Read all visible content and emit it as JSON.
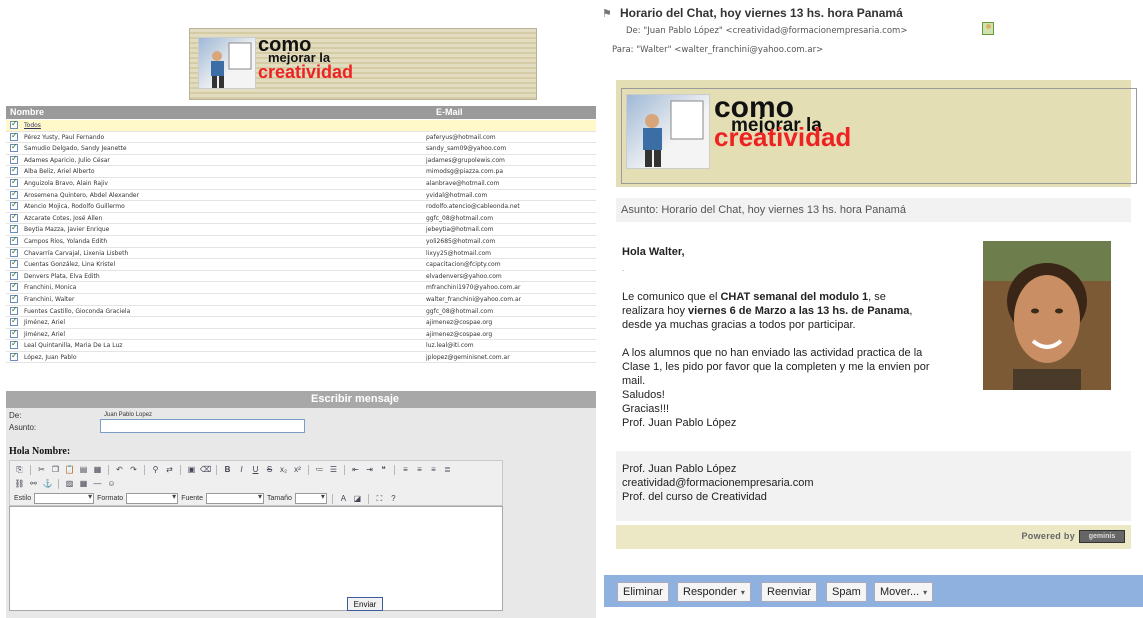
{
  "banner": {
    "line1": "como",
    "line2": "mejorar la",
    "line3": "creatividad"
  },
  "list": {
    "col_name": "Nombre",
    "col_email": "E-Mail",
    "all_label": "Todos",
    "contacts": [
      {
        "name": "Pérez Yusty, Paul Fernando",
        "email": "paferyus@hotmail.com"
      },
      {
        "name": "Samudio Delgado, Sandy Jeanette",
        "email": "sandy_sam09@yahoo.com"
      },
      {
        "name": "Adames Aparicio, Julio César",
        "email": "jadames@grupolewis.com"
      },
      {
        "name": "Alba Beliz, Ariel Alberto",
        "email": "mimodsg@piazza.com.pa"
      },
      {
        "name": "Anguizola Bravo, Alain Rajiv",
        "email": "alanbrave@hotmail.com"
      },
      {
        "name": "Arosemena Quintero, Abdel Alexander",
        "email": "yvidal@hotmail.com"
      },
      {
        "name": "Atencio Mojica, Rodolfo Guillermo",
        "email": "rodolfo.atencio@cableonda.net"
      },
      {
        "name": "Azcarate Cotes, José Allen",
        "email": "ggfc_08@hotmail.com"
      },
      {
        "name": "Beytia Mazza, Javier Enrique",
        "email": "jebeytia@hotmail.com"
      },
      {
        "name": "Campos Ríos, Yolanda Edith",
        "email": "yoli2685@hotmail.com"
      },
      {
        "name": "Chavarría Carvajal, Lixenia Lisbeth",
        "email": "lixyy25@hotmail.com"
      },
      {
        "name": "Cuentas González, Lina Kristel",
        "email": "capacitacion@fcipty.com"
      },
      {
        "name": "Denvers Plata, Elva Edith",
        "email": "elvadenvers@yahoo.com"
      },
      {
        "name": "Franchini, Monica",
        "email": "mfranchini1970@yahoo.com.ar"
      },
      {
        "name": "Franchini, Walter",
        "email": "walter_franchini@yahoo.com.ar"
      },
      {
        "name": "Fuentes Castillo, Gioconda Graciela",
        "email": "ggfc_08@hotmail.com"
      },
      {
        "name": "Jiménez, Ariel",
        "email": "ajimenez@cospae.org"
      },
      {
        "name": "Jiménez, Ariel",
        "email": "ajimenez@cospae.org"
      },
      {
        "name": "Leal Quintanilla, Maria De La Luz",
        "email": "luz.leal@iti.com"
      },
      {
        "name": "López, Juan Pablo",
        "email": "jplopez@geminisnet.com.ar"
      }
    ]
  },
  "compose": {
    "header": "Escribir mensaje",
    "from_label": "De:",
    "from_value": "Juan Pablo Lopez",
    "subject_label": "Asunto:",
    "subject_value": "",
    "greeting": "Hola Nombre:",
    "style_label": "Estilo",
    "format_label": "Formato",
    "font_label": "Fuente",
    "size_label": "Tamaño",
    "send_label": "Enviar"
  },
  "email": {
    "subject": "Horario del Chat, hoy viernes 13 hs. hora Panamá",
    "from": "De:  \"Juan Pablo López\" <creatividad@formacionempresaria.com>",
    "to": "Para:  \"Walter\" <walter_franchini@yahoo.com.ar>",
    "asunto_line": "Asunto: Horario del Chat, hoy viernes 13 hs. hora Panamá",
    "greeting": "Hola Walter,",
    "dot": ".",
    "p1_a": "Le  comunico que el ",
    "p1_b": "CHAT semanal del modulo 1",
    "p1_c": ", se",
    "p1_d": "realizara hoy ",
    "p1_e": "viernes 6 de Marzo a las 13 hs. de Panama",
    "p1_f": ",",
    "p1_g": "desde ya muchas gracias a todos por participar.",
    "p2_1": "A los alumnos que no han enviado las actividad practica de la",
    "p2_2": "Clase 1, les pido por favor que la completen y me la envien por",
    "p2_3": "mail.",
    "p2_4": "Saludos!",
    "p2_5": "Gracias!!!",
    "p2_6": " Prof. Juan Pablo López",
    "sig1": "Prof. Juan Pablo López",
    "sig2": "creatividad@formacionempresaria.com",
    "sig3": "Prof. del curso de Creatividad",
    "powered": "Powered by",
    "powered_logo": "geminis"
  },
  "actions": {
    "delete": "Eliminar",
    "reply": "Responder",
    "forward": "Reenviar",
    "spam": "Spam",
    "move": "Mover..."
  }
}
